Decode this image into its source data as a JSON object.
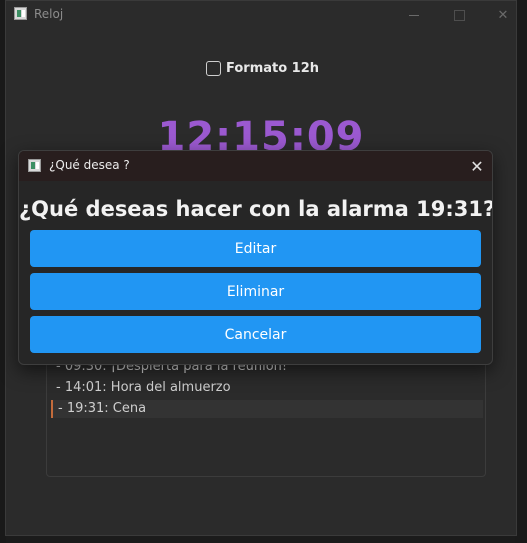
{
  "window": {
    "title": "Reloj"
  },
  "format": {
    "label": "Formato 12h",
    "checked": false
  },
  "clock": {
    "time": "12:15:09"
  },
  "alarms": [
    {
      "text": "- 09:30: ¡Despierta para la reunión!"
    },
    {
      "text": "- 14:01: Hora del almuerzo"
    },
    {
      "text": "- 19:31: Cena"
    }
  ],
  "dialog": {
    "title": "¿Qué desea ?",
    "question": "¿Qué deseas hacer con la alarma 19:31?",
    "buttons": {
      "edit": "Editar",
      "delete": "Eliminar",
      "cancel": "Cancelar"
    }
  },
  "colors": {
    "button": "#2196f3",
    "clock": "#9b59d0"
  },
  "icons": {
    "app": "app-icon",
    "close": "close-icon",
    "minimize": "minimize-icon",
    "maximize": "maximize-icon"
  }
}
